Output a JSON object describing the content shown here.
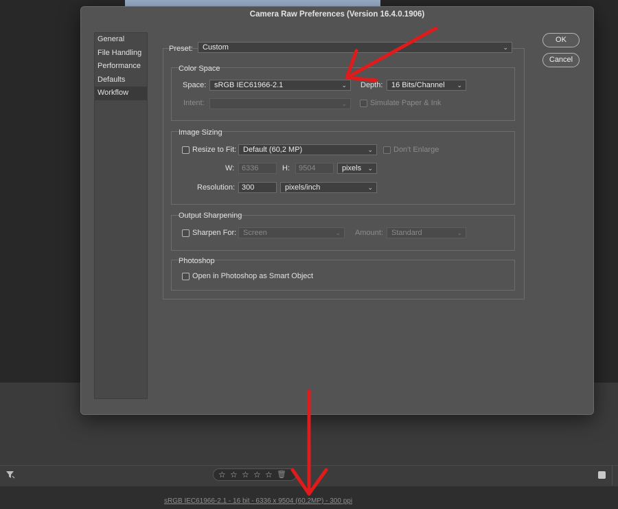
{
  "dialog": {
    "title": "Camera Raw Preferences  (Version 16.4.0.1906)",
    "ok_label": "OK",
    "cancel_label": "Cancel"
  },
  "nav": {
    "items": [
      {
        "label": "General"
      },
      {
        "label": "File Handling"
      },
      {
        "label": "Performance"
      },
      {
        "label": "Defaults"
      },
      {
        "label": "Workflow",
        "selected": true
      }
    ]
  },
  "preset": {
    "label": "Preset:",
    "value": "Custom"
  },
  "color_space": {
    "title": "Color Space",
    "space_label": "Space:",
    "space_value": "sRGB IEC61966-2.1",
    "depth_label": "Depth:",
    "depth_value": "16 Bits/Channel",
    "intent_label": "Intent:",
    "intent_value": "",
    "simulate_label": "Simulate Paper & Ink"
  },
  "image_sizing": {
    "title": "Image Sizing",
    "resize_label": "Resize to Fit:",
    "resize_value": "Default  (60,2 MP)",
    "dont_enlarge_label": "Don't Enlarge",
    "w_label": "W:",
    "w_value": "6336",
    "h_label": "H:",
    "h_value": "9504",
    "unit_value": "pixels",
    "resolution_label": "Resolution:",
    "resolution_value": "300",
    "resolution_unit": "pixels/inch"
  },
  "output_sharpening": {
    "title": "Output Sharpening",
    "sharpen_label": "Sharpen For:",
    "sharpen_value": "Screen",
    "amount_label": "Amount:",
    "amount_value": "Standard"
  },
  "photoshop": {
    "title": "Photoshop",
    "smart_object_label": "Open in Photoshop as Smart Object"
  },
  "filmstrip": {
    "stars": [
      "☆",
      "☆",
      "☆",
      "☆",
      "☆"
    ],
    "trash_icon": "🗑"
  },
  "status_bar": {
    "text": "sRGB IEC61966-2.1 - 16 bit - 6336 x 9504 (60,2MP) - 300 ppi"
  },
  "annotation_color": "#e01b1b"
}
